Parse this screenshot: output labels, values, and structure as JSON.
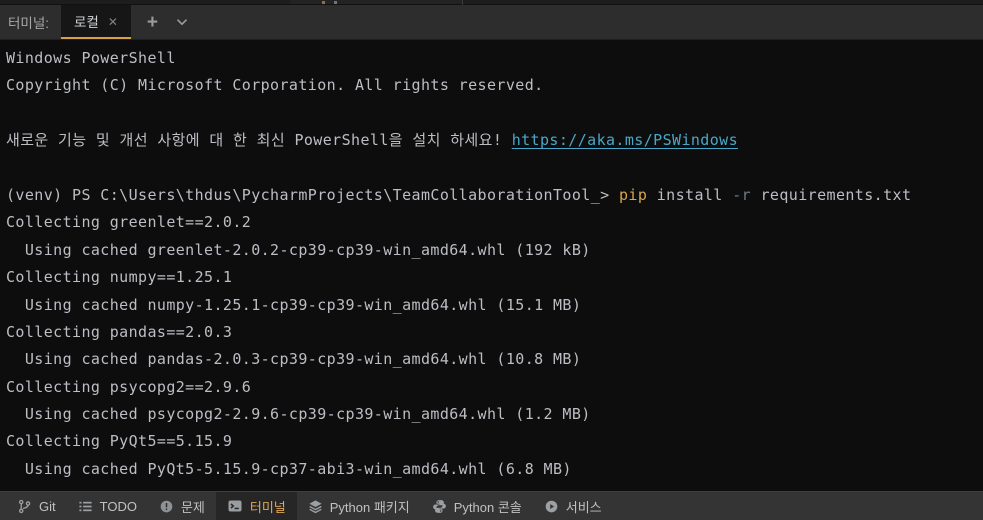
{
  "header": {
    "panel_label": "터미널:",
    "tab": {
      "label": "로컬",
      "close_glyph": "✕"
    },
    "new_tab_glyph": "+"
  },
  "terminal": {
    "lines": [
      {
        "segments": [
          {
            "text": "Windows PowerShell",
            "color": "default"
          }
        ]
      },
      {
        "segments": [
          {
            "text": "Copyright (C) Microsoft Corporation. All rights reserved.",
            "color": "default"
          }
        ]
      },
      {
        "segments": []
      },
      {
        "segments": [
          {
            "text": "새로운 기능 및 개선 사항에 대 한 최신 PowerShell을 설치 하세요! ",
            "color": "default"
          },
          {
            "text": "https://aka.ms/PSWindows",
            "color": "link"
          }
        ]
      },
      {
        "segments": []
      },
      {
        "segments": [
          {
            "text": "(venv) PS C:\\Users\\thdus\\PycharmProjects\\TeamCollaborationTool_> ",
            "color": "default"
          },
          {
            "text": "pip",
            "color": "command"
          },
          {
            "text": " install ",
            "color": "default"
          },
          {
            "text": "-r",
            "color": "flag"
          },
          {
            "text": " requirements.txt",
            "color": "default"
          }
        ]
      },
      {
        "segments": [
          {
            "text": "Collecting greenlet==2.0.2",
            "color": "default"
          }
        ]
      },
      {
        "segments": [
          {
            "text": "  Using cached greenlet-2.0.2-cp39-cp39-win_amd64.whl (192 kB)",
            "color": "default"
          }
        ]
      },
      {
        "segments": [
          {
            "text": "Collecting numpy==1.25.1",
            "color": "default"
          }
        ]
      },
      {
        "segments": [
          {
            "text": "  Using cached numpy-1.25.1-cp39-cp39-win_amd64.whl (15.1 MB)",
            "color": "default"
          }
        ]
      },
      {
        "segments": [
          {
            "text": "Collecting pandas==2.0.3",
            "color": "default"
          }
        ]
      },
      {
        "segments": [
          {
            "text": "  Using cached pandas-2.0.3-cp39-cp39-win_amd64.whl (10.8 MB)",
            "color": "default"
          }
        ]
      },
      {
        "segments": [
          {
            "text": "Collecting psycopg2==2.9.6",
            "color": "default"
          }
        ]
      },
      {
        "segments": [
          {
            "text": "  Using cached psycopg2-2.9.6-cp39-cp39-win_amd64.whl (1.2 MB)",
            "color": "default"
          }
        ]
      },
      {
        "segments": [
          {
            "text": "Collecting PyQt5==5.15.9",
            "color": "default"
          }
        ]
      },
      {
        "segments": [
          {
            "text": "  Using cached PyQt5-5.15.9-cp37-abi3-win_amd64.whl (6.8 MB)",
            "color": "default"
          }
        ]
      }
    ]
  },
  "status_bar": {
    "items": [
      {
        "label": "Git"
      },
      {
        "label": "TODO"
      },
      {
        "label": "문제"
      },
      {
        "label": "터미널",
        "active": true
      },
      {
        "label": "Python 패키지"
      },
      {
        "label": "Python 콘솔"
      },
      {
        "label": "서비스"
      }
    ]
  },
  "colors": {
    "accent_underline": "#d5a343",
    "terminal_bg": "#0d0d0d",
    "terminal_text": "#bcbec4",
    "link": "#4aa6c9",
    "command": "#d7a64c",
    "flag": "#6e7a84",
    "status_active_text": "#e2a755"
  }
}
